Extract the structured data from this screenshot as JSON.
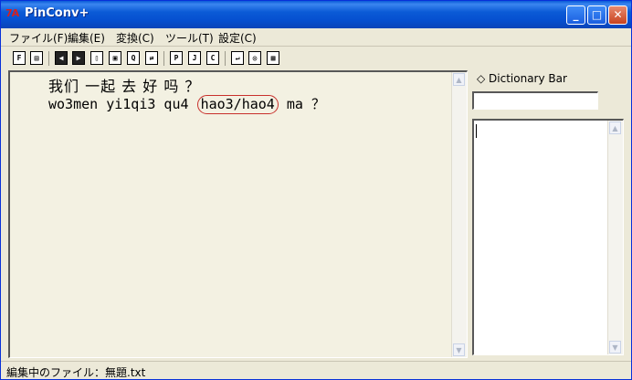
{
  "window": {
    "title": "PinConv+",
    "app_icon": "7A",
    "controls": {
      "minimize": "_",
      "maximize": "□",
      "close": "✕"
    }
  },
  "menu": [
    "ファイル(F)",
    "編集(E)",
    "変換(C)",
    "ツール(T)",
    "設定(C)"
  ],
  "toolbar": {
    "tools": [
      {
        "icon": "open-file-icon",
        "glyph": "F"
      },
      {
        "icon": "save-icon",
        "glyph": "▤"
      },
      {
        "icon": "prev-icon",
        "glyph": "◀"
      },
      {
        "icon": "next-icon",
        "glyph": "▶"
      },
      {
        "icon": "copy-icon",
        "glyph": "▯"
      },
      {
        "icon": "paste-icon",
        "glyph": "▣"
      },
      {
        "icon": "find-icon",
        "glyph": "Q"
      },
      {
        "icon": "replace-icon",
        "glyph": "⇄"
      },
      {
        "icon": "pinyin-icon",
        "glyph": "P"
      },
      {
        "icon": "jump-icon",
        "glyph": "J"
      },
      {
        "icon": "convert-icon",
        "glyph": "C"
      },
      {
        "icon": "wrap-icon",
        "glyph": "↵"
      },
      {
        "icon": "settings-icon",
        "glyph": "◎"
      },
      {
        "icon": "dict-icon",
        "glyph": "▦"
      }
    ]
  },
  "editor": {
    "hanzi": "我们 一起 去 好 吗 ？",
    "pinyin_before": "wo3men yi1qi3 qu4",
    "pinyin_highlight": "hao3/hao4",
    "pinyin_after": "ma ？"
  },
  "dictionary": {
    "label": "◇ Dictionary Bar",
    "input_value": ""
  },
  "status": "編集中のファイル：無題.txt"
}
